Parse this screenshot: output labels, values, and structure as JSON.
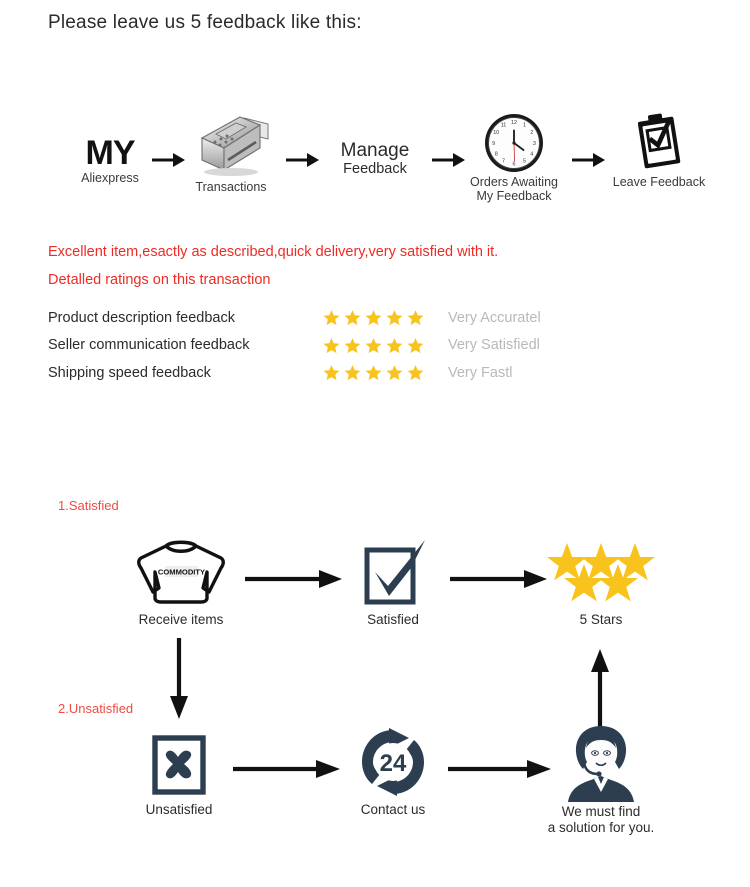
{
  "heading": "Please leave us 5 feedback like this:",
  "colors": {
    "red_text": "#ee2b24",
    "section_label_red": "#ee4b45",
    "star_gold": "#f7c31c",
    "navy": "#2c3e50",
    "gray_value": "#b9b9b9",
    "body_text": "#2b2b2b"
  },
  "top_flow": {
    "steps": [
      {
        "id": "my-aliexpress",
        "icon": "my-aliexpress-logo",
        "title": "MY",
        "caption": "Aliexpress"
      },
      {
        "id": "transactions",
        "icon": "pos-terminal-icon",
        "caption": "Transactions"
      },
      {
        "id": "manage-feedback",
        "icon": "manage-feedback-text",
        "title": "Manage",
        "caption": "Feedback"
      },
      {
        "id": "orders-awaiting",
        "icon": "clock-icon",
        "caption": "Orders Awaiting\nMy Feedback",
        "caption_line1": "Orders Awaiting",
        "caption_line2": "My Feedback"
      },
      {
        "id": "leave-feedback",
        "icon": "clipboard-check-icon",
        "caption": "Leave Feedback"
      }
    ],
    "arrow_count": 4
  },
  "review": {
    "line1": "Excellent item,esactly as described,quick delivery,very satisfied with it.",
    "line2": "Detalled ratings on this transaction"
  },
  "ratings": [
    {
      "label": "Product description feedback",
      "stars": 5,
      "value": "Very Accuratel"
    },
    {
      "label": "Seller communication feedback",
      "stars": 5,
      "value": "Very Satisfiedl"
    },
    {
      "label": "Shipping speed feedback",
      "stars": 5,
      "value": "Very Fastl"
    }
  ],
  "bottom_flow": {
    "section_1_label": "1.Satisfied",
    "section_2_label": "2.Unsatisfied",
    "row1": [
      {
        "id": "receive-items",
        "icon": "sweater-commodity-icon",
        "icon_text": "COMMODITY",
        "caption": "Receive items"
      },
      {
        "id": "satisfied",
        "icon": "checkbox-check-icon",
        "caption": "Satisfied"
      },
      {
        "id": "five-stars",
        "icon": "five-stars-icon",
        "caption": "5 Stars",
        "star_count": 5
      }
    ],
    "row2": [
      {
        "id": "unsatisfied",
        "icon": "checkbox-x-icon",
        "caption": "Unsatisfied"
      },
      {
        "id": "contact-us",
        "icon": "support-24-icon",
        "icon_text": "24",
        "caption": "Contact us"
      },
      {
        "id": "resolution",
        "icon": "support-agent-icon",
        "caption_line1": "We must find",
        "caption_line2": "a solution for you."
      }
    ]
  }
}
